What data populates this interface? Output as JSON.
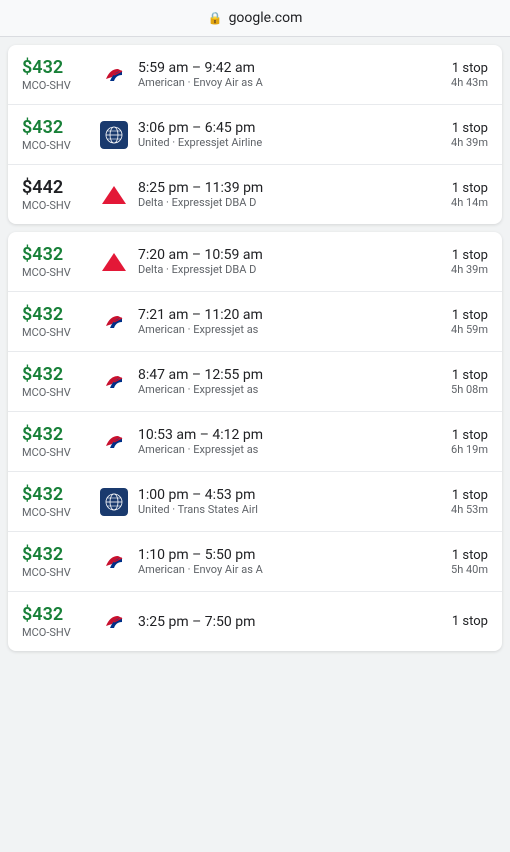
{
  "browser": {
    "url": "google.com",
    "lock_label": "🔒"
  },
  "card1": {
    "flights": [
      {
        "price": "$432",
        "price_style": "green",
        "route": "MCO-SHV",
        "airline_code": "american",
        "departure": "5:59 am",
        "arrival": "9:42 am",
        "stops": "1 stop",
        "duration": "4h 43m",
        "airline_detail": "American · Envoy Air as A"
      },
      {
        "price": "$432",
        "price_style": "green",
        "route": "MCO-SHV",
        "airline_code": "united",
        "departure": "3:06 pm",
        "arrival": "6:45 pm",
        "stops": "1 stop",
        "duration": "4h 39m",
        "airline_detail": "United · Expressjet Airline"
      },
      {
        "price": "$442",
        "price_style": "black",
        "route": "MCO-SHV",
        "airline_code": "delta",
        "departure": "8:25 pm",
        "arrival": "11:39 pm",
        "stops": "1 stop",
        "duration": "4h 14m",
        "airline_detail": "Delta · Expressjet DBA D"
      }
    ]
  },
  "card2": {
    "flights": [
      {
        "price": "$432",
        "price_style": "green",
        "route": "MCO-SHV",
        "airline_code": "delta",
        "departure": "7:20 am",
        "arrival": "10:59 am",
        "stops": "1 stop",
        "duration": "4h 39m",
        "airline_detail": "Delta · Expressjet DBA D"
      },
      {
        "price": "$432",
        "price_style": "green",
        "route": "MCO-SHV",
        "airline_code": "american",
        "departure": "7:21 am",
        "arrival": "11:20 am",
        "stops": "1 stop",
        "duration": "4h 59m",
        "airline_detail": "American · Expressjet as"
      },
      {
        "price": "$432",
        "price_style": "green",
        "route": "MCO-SHV",
        "airline_code": "american",
        "departure": "8:47 am",
        "arrival": "12:55 pm",
        "stops": "1 stop",
        "duration": "5h 08m",
        "airline_detail": "American · Expressjet as"
      },
      {
        "price": "$432",
        "price_style": "green",
        "route": "MCO-SHV",
        "airline_code": "american",
        "departure": "10:53 am",
        "arrival": "4:12 pm",
        "stops": "1 stop",
        "duration": "6h 19m",
        "airline_detail": "American · Expressjet as"
      },
      {
        "price": "$432",
        "price_style": "green",
        "route": "MCO-SHV",
        "airline_code": "united",
        "departure": "1:00 pm",
        "arrival": "4:53 pm",
        "stops": "1 stop",
        "duration": "4h 53m",
        "airline_detail": "United · Trans States Airl"
      },
      {
        "price": "$432",
        "price_style": "green",
        "route": "MCO-SHV",
        "airline_code": "american",
        "departure": "1:10 pm",
        "arrival": "5:50 pm",
        "stops": "1 stop",
        "duration": "5h 40m",
        "airline_detail": "American · Envoy Air as A"
      },
      {
        "price": "$432",
        "price_style": "green",
        "route": "MCO-SHV",
        "airline_code": "american",
        "departure": "3:25 pm",
        "arrival": "7:50 pm",
        "stops": "1 stop",
        "duration": "",
        "airline_detail": ""
      }
    ]
  }
}
